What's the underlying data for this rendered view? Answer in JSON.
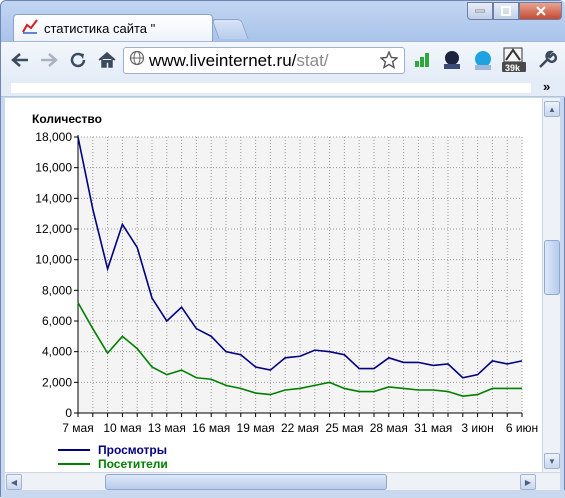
{
  "browser": {
    "tab_title": "статистика сайта \"",
    "url_host": "www.liveinternet.ru/",
    "url_path": "stat/",
    "extension_badge": "39k",
    "chevron": "»"
  },
  "chart_data": {
    "type": "line",
    "ylabel": "Количество",
    "ylim": [
      0,
      18000
    ],
    "yticks": [
      "0",
      "2,000",
      "4,000",
      "6,000",
      "8,000",
      "10,000",
      "12,000",
      "14,000",
      "16,000",
      "18,000"
    ],
    "xticks": [
      "7 мая",
      "10 мая",
      "13 мая",
      "16 мая",
      "19 мая",
      "22 мая",
      "25 мая",
      "28 мая",
      "31 мая",
      "3 июн",
      "6 июн"
    ],
    "days": 31,
    "grid": true,
    "legend_position": "bottom-left",
    "series": [
      {
        "name": "Просмотры",
        "color": "#000080",
        "values": [
          18000,
          13300,
          9400,
          12300,
          10800,
          7500,
          6000,
          6900,
          5500,
          5000,
          4000,
          3800,
          3000,
          2800,
          3600,
          3700,
          4100,
          4000,
          3800,
          2900,
          2900,
          3600,
          3300,
          3300,
          3100,
          3200,
          2300,
          2500,
          3400,
          3200,
          3400
        ]
      },
      {
        "name": "Посетители",
        "color": "#008000",
        "values": [
          7200,
          5500,
          3900,
          5000,
          4200,
          3000,
          2500,
          2800,
          2300,
          2200,
          1800,
          1600,
          1300,
          1200,
          1500,
          1600,
          1800,
          2000,
          1600,
          1400,
          1400,
          1700,
          1600,
          1500,
          1500,
          1400,
          1100,
          1200,
          1600,
          1600,
          1600
        ]
      }
    ]
  }
}
